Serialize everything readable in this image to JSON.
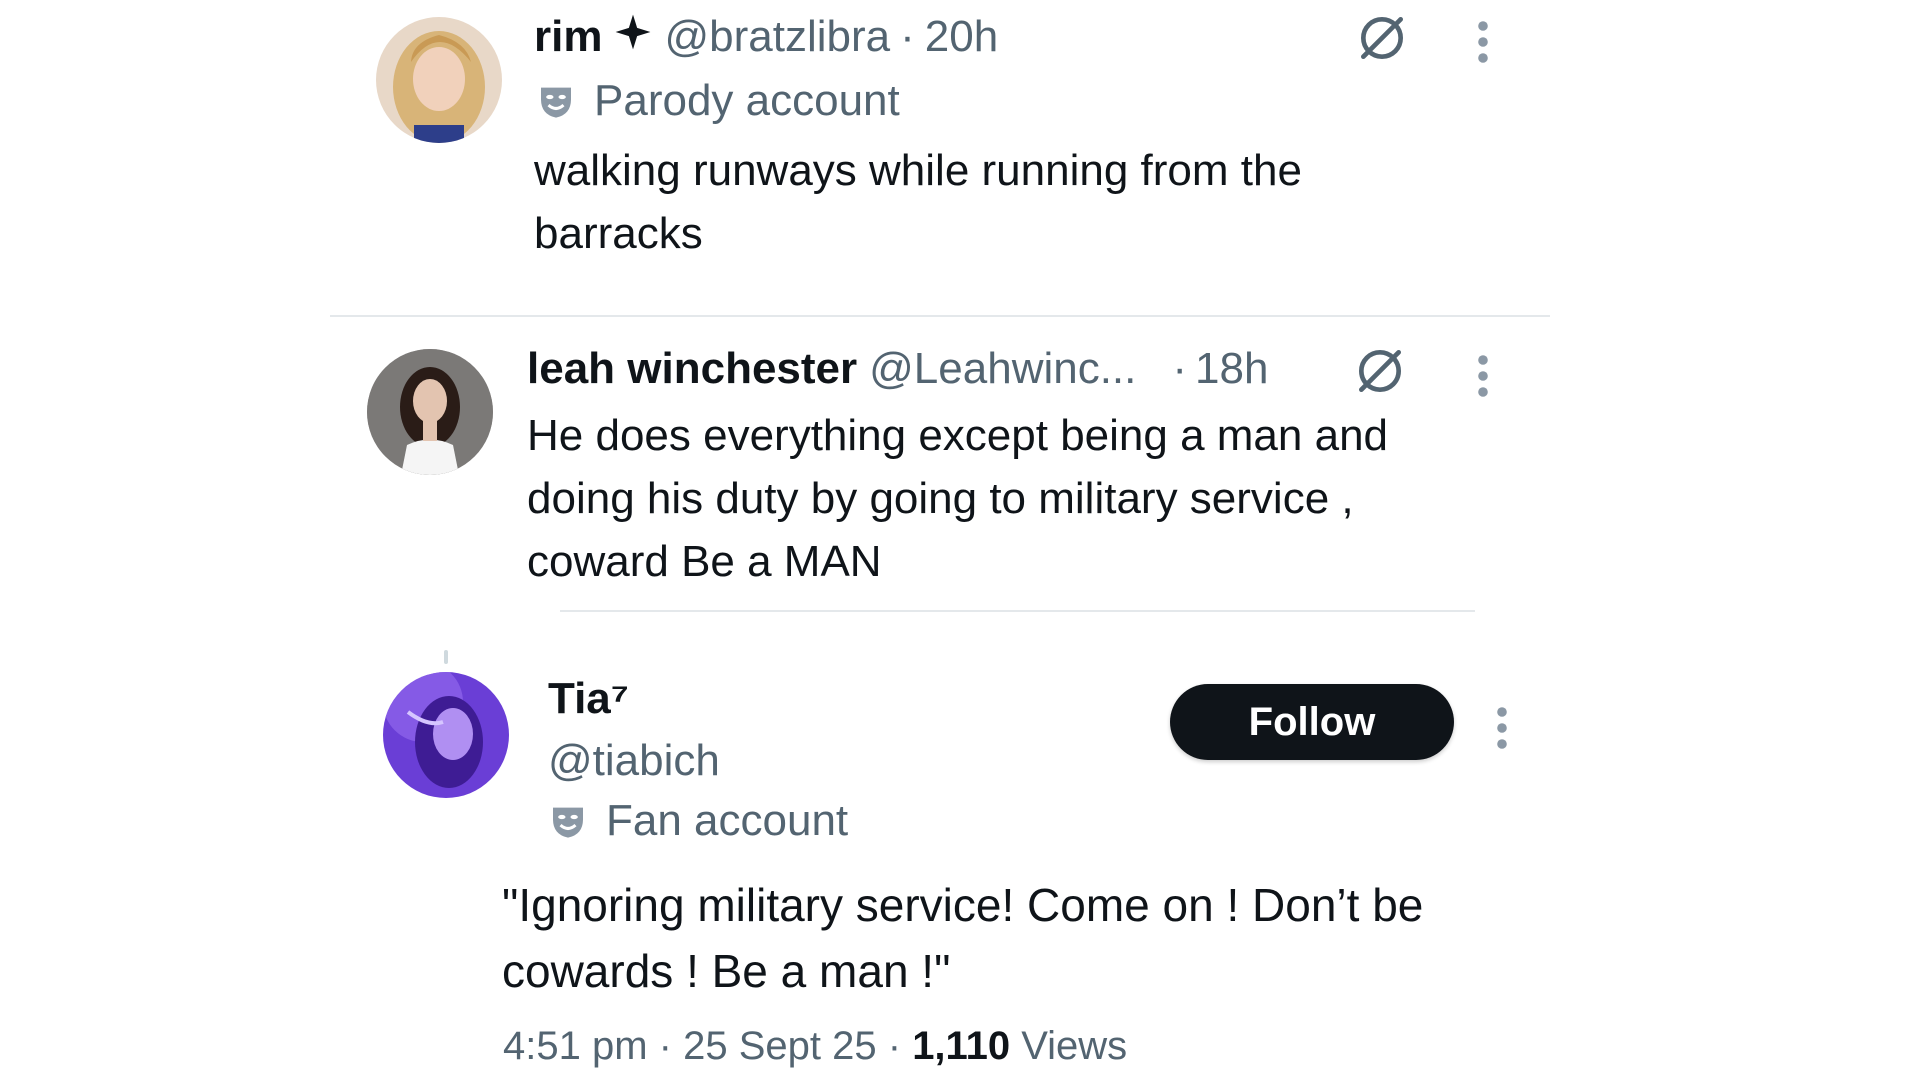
{
  "posts": [
    {
      "display_name": "rim",
      "badge_icon": "sparkle-icon",
      "handle": "@bratzlibra",
      "separator": "·",
      "time": "20h",
      "label_icon": "mask-icon",
      "label": "Parody account",
      "text": "walking runways while running from the barracks",
      "actions": [
        "grok-icon",
        "more-vertical-icon"
      ]
    },
    {
      "display_name": "leah winchester",
      "handle": "@Leahwinc...",
      "separator": "·",
      "time": "18h",
      "text": "He does everything except being a man and doing his duty by going to military service , coward Be a MAN",
      "actions": [
        "grok-icon",
        "more-vertical-icon"
      ]
    },
    {
      "display_name": "Tia⁷",
      "handle": "@tiabich",
      "label_icon": "mask-icon",
      "label": "Fan account",
      "follow_label": "Follow",
      "text": "\"Ignoring military service! Come on ! Don’t be cowards ! Be a man !\"",
      "time": "4:51 pm",
      "date": "25 Sept 25",
      "separator": "·",
      "views_count": "1,110",
      "views_label": "Views",
      "actions": [
        "more-vertical-icon"
      ]
    }
  ],
  "colors": {
    "text_primary": "#0f1419",
    "text_secondary": "#536471",
    "divider": "#e4e8eb",
    "follow_bg": "#0f1419",
    "follow_text": "#ffffff"
  }
}
